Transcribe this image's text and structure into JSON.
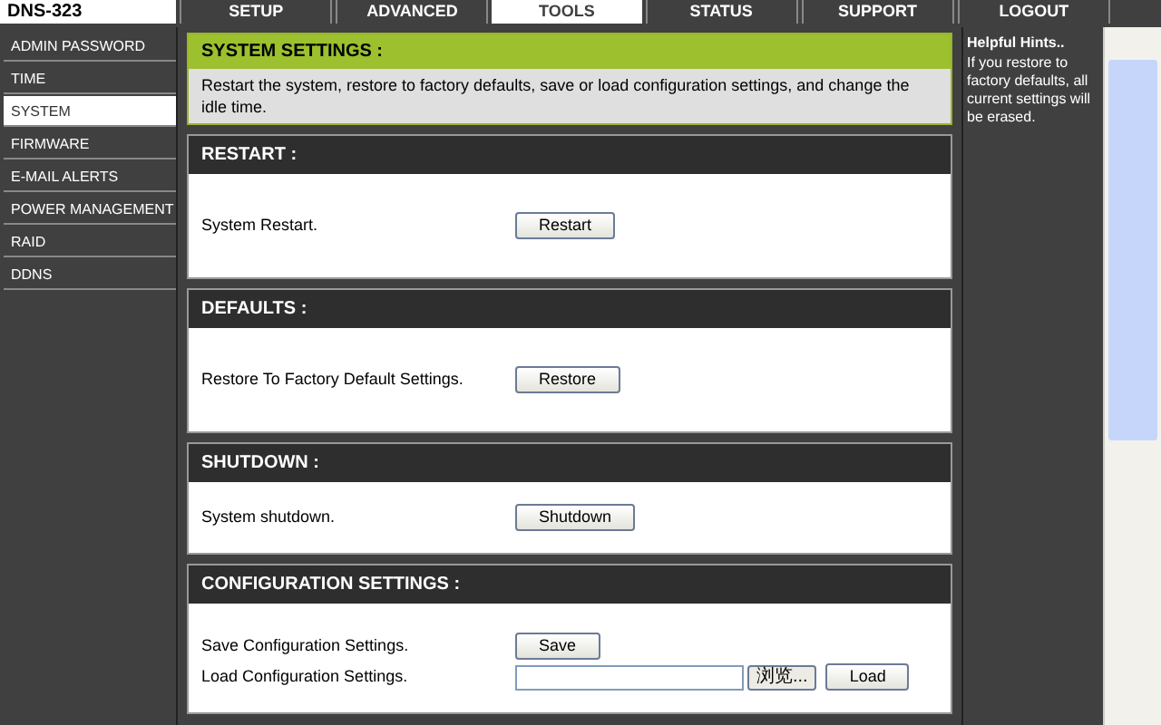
{
  "logo": "DNS-323",
  "tabs": [
    {
      "label": "SETUP",
      "selected": false
    },
    {
      "label": "ADVANCED",
      "selected": false
    },
    {
      "label": "TOOLS",
      "selected": true
    },
    {
      "label": "STATUS",
      "selected": false
    },
    {
      "label": "SUPPORT",
      "selected": false
    },
    {
      "label": "LOGOUT",
      "selected": false
    }
  ],
  "sidebar": {
    "items": [
      {
        "label": "ADMIN PASSWORD",
        "selected": false
      },
      {
        "label": "TIME",
        "selected": false
      },
      {
        "label": "SYSTEM",
        "selected": true
      },
      {
        "label": "FIRMWARE",
        "selected": false
      },
      {
        "label": "E-MAIL ALERTS",
        "selected": false
      },
      {
        "label": "POWER MANAGEMENT",
        "selected": false
      },
      {
        "label": "RAID",
        "selected": false
      },
      {
        "label": "DDNS",
        "selected": false
      }
    ]
  },
  "intro": {
    "title": "SYSTEM SETTINGS :",
    "text": "Restart the system, restore to factory defaults, save or load configuration settings, and change the idle time."
  },
  "sections": [
    {
      "title": "RESTART :",
      "rows": [
        {
          "label": "System Restart.",
          "controls": [
            {
              "kind": "button",
              "label": "Restart"
            }
          ]
        }
      ]
    },
    {
      "title": "DEFAULTS :",
      "rows": [
        {
          "label": "Restore To Factory Default Settings.",
          "controls": [
            {
              "kind": "button",
              "label": "Restore"
            }
          ]
        }
      ]
    },
    {
      "title": "SHUTDOWN :",
      "rows": [
        {
          "label": "System shutdown.",
          "controls": [
            {
              "kind": "button",
              "label": "Shutdown"
            }
          ]
        }
      ]
    },
    {
      "title": "CONFIGURATION SETTINGS :",
      "rows": [
        {
          "label": "Save Configuration Settings.",
          "controls": [
            {
              "kind": "button",
              "label": "Save"
            }
          ]
        },
        {
          "label": "Load Configuration Settings.",
          "controls": [
            {
              "kind": "file",
              "browse": "浏览..."
            },
            {
              "kind": "button",
              "label": "Load"
            }
          ]
        }
      ]
    }
  ],
  "hints": {
    "title": "Helpful Hints..",
    "text": "If you restore to factory defaults, all current settings will be erased."
  }
}
